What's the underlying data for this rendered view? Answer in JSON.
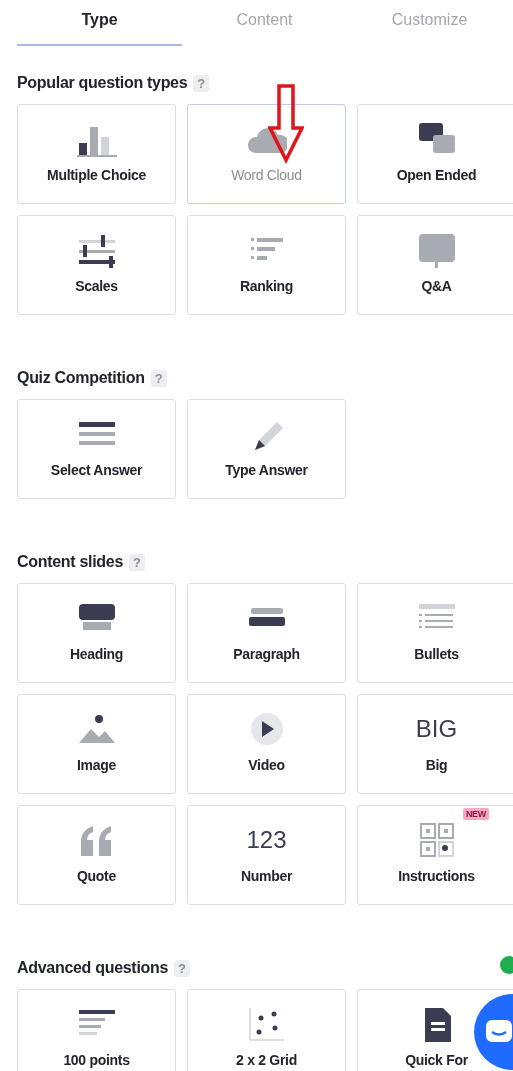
{
  "tabs": [
    {
      "label": "Type",
      "selected": true
    },
    {
      "label": "Content",
      "selected": false
    },
    {
      "label": "Customize",
      "selected": false
    }
  ],
  "sections": [
    {
      "title": "Popular question types",
      "help": "?",
      "tiles": [
        {
          "label": "Multiple Choice",
          "hovered": false
        },
        {
          "label": "Word Cloud",
          "hovered": true
        },
        {
          "label": "Open Ended",
          "hovered": false
        },
        {
          "label": "Scales",
          "hovered": false
        },
        {
          "label": "Ranking",
          "hovered": false
        },
        {
          "label": "Q&A",
          "hovered": false
        }
      ]
    },
    {
      "title": "Quiz Competition",
      "help": "?",
      "tiles": [
        {
          "label": "Select Answer",
          "hovered": false
        },
        {
          "label": "Type Answer",
          "hovered": false
        }
      ]
    },
    {
      "title": "Content slides",
      "help": "?",
      "tiles": [
        {
          "label": "Heading",
          "hovered": false
        },
        {
          "label": "Paragraph",
          "hovered": false
        },
        {
          "label": "Bullets",
          "hovered": false
        },
        {
          "label": "Image",
          "hovered": false
        },
        {
          "label": "Video",
          "hovered": false
        },
        {
          "label": "Big",
          "hovered": false,
          "glyph": "BIG"
        },
        {
          "label": "Quote",
          "hovered": false
        },
        {
          "label": "Number",
          "hovered": false,
          "glyph": "123"
        },
        {
          "label": "Instructions",
          "hovered": false,
          "badge": "NEW"
        }
      ]
    },
    {
      "title": "Advanced questions",
      "help": "?",
      "tiles": [
        {
          "label": "100 points",
          "hovered": false
        },
        {
          "label": "2 x 2 Grid",
          "hovered": false
        },
        {
          "label": "Quick For",
          "hovered": false
        }
      ]
    }
  ]
}
